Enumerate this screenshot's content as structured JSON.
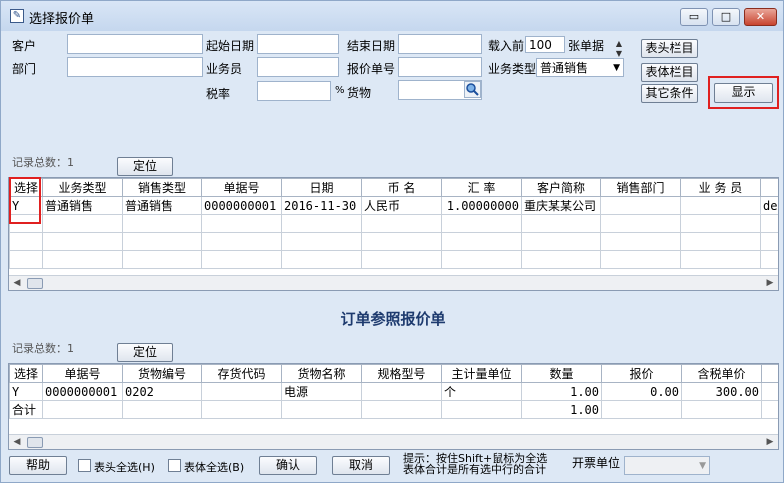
{
  "window": {
    "title": "选择报价单"
  },
  "window_controls": {
    "minimize": "▭",
    "restore": "□",
    "close": "✕"
  },
  "filters": {
    "customer_label": "客户",
    "customer_value": "",
    "start_date_label": "起始日期",
    "start_date_value": "",
    "end_date_label": "结束日期",
    "end_date_value": "",
    "load_prefix": "载入前",
    "load_count": "100",
    "load_suffix": "张单据",
    "department_label": "部门",
    "department_value": "",
    "salesperson_label": "业务员",
    "salesperson_value": "",
    "quote_no_label": "报价单号",
    "quote_no_value": "",
    "biz_type_label": "业务类型",
    "biz_type_value": "普通销售",
    "tax_rate_label": "税率",
    "tax_rate_value": "",
    "tax_rate_unit": "%",
    "goods_label": "货物",
    "goods_value": ""
  },
  "buttons": {
    "header_columns": "表头栏目",
    "body_columns": "表体栏目",
    "other_conditions": "其它条件",
    "display": "显示",
    "locate": "定位",
    "help": "帮助",
    "confirm": "确认",
    "cancel": "取消"
  },
  "top_grid": {
    "record_count_label": "记录总数：1",
    "columns": [
      "选择",
      "业务类型",
      "销售类型",
      "单据号",
      "日期",
      "币 名",
      "汇 率",
      "客户简称",
      "销售部门",
      "业 务 员",
      ""
    ],
    "rows": [
      [
        "Y",
        "普通销售",
        "普通销售",
        "0000000001",
        "2016-11-30",
        "人民币",
        "1.00000000",
        "重庆某某公司",
        "",
        "",
        "de"
      ]
    ]
  },
  "section_title": "订单参照报价单",
  "bottom_grid": {
    "record_count_label": "记录总数：1",
    "columns": [
      "选择",
      "单据号",
      "货物编号",
      "存货代码",
      "货物名称",
      "规格型号",
      "主计量单位",
      "数量",
      "报价",
      "含税单价",
      ""
    ],
    "rows": [
      [
        "Y",
        "0000000001",
        "0202",
        "",
        "电源",
        "",
        "个",
        "1.00",
        "0.00",
        "300.00",
        ""
      ],
      [
        "合计",
        "",
        "",
        "",
        "",
        "",
        "",
        "1.00",
        "",
        "",
        ""
      ]
    ]
  },
  "footer": {
    "select_all_header": "表头全选(H)",
    "select_all_body": "表体全选(B)",
    "hint_line1": "提示：按住Shift+鼠标为全选",
    "hint_line2": "表体合计是所有选中行的合计",
    "invoice_unit_label": "开票单位",
    "invoice_unit_value": ""
  }
}
